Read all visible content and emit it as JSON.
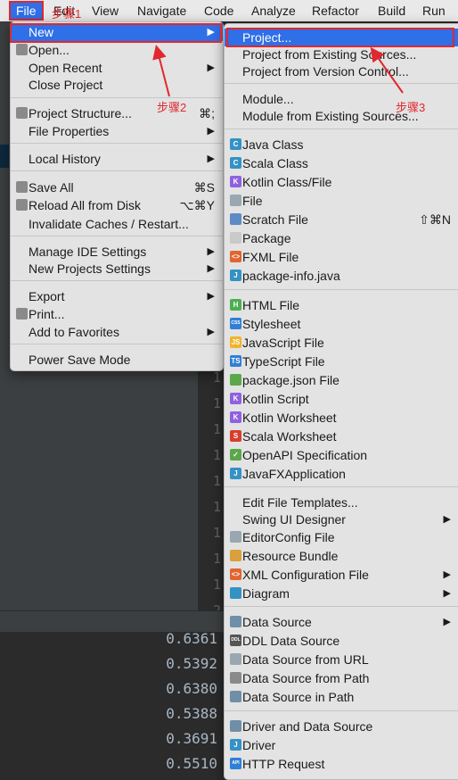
{
  "menubar": {
    "items": [
      "File",
      "Edit",
      "View",
      "Navigate",
      "Code",
      "Analyze",
      "Refactor",
      "Build",
      "Run"
    ]
  },
  "ide": {
    "gutter_numbers": [
      "1",
      "1",
      "1",
      "1",
      "1",
      "1",
      "1",
      "1",
      "1",
      "2"
    ],
    "output_values": [
      "0.6361",
      "0.5392",
      "0.6380",
      "0.5388",
      "0.3691",
      "0.5510"
    ]
  },
  "file_menu": {
    "items": [
      {
        "label": "New",
        "arrow": "▶",
        "selected": true
      },
      {
        "label": "Open...",
        "icon": "folder-icon"
      },
      {
        "label": "Open Recent",
        "arrow": "▶"
      },
      {
        "label": "Close Project"
      },
      {
        "label": "Project Structure...",
        "icon": "project-structure-icon",
        "shortcut": "⌘;"
      },
      {
        "label": "File Properties",
        "arrow": "▶"
      },
      {
        "label": "Local History",
        "arrow": "▶"
      },
      {
        "label": "Save All",
        "icon": "save-icon",
        "shortcut": "⌘S"
      },
      {
        "label": "Reload All from Disk",
        "icon": "reload-icon",
        "shortcut": "⌥⌘Y"
      },
      {
        "label": "Invalidate Caches / Restart..."
      },
      {
        "label": "Manage IDE Settings",
        "arrow": "▶"
      },
      {
        "label": "New Projects Settings",
        "arrow": "▶"
      },
      {
        "label": "Export",
        "arrow": "▶"
      },
      {
        "label": "Print...",
        "icon": "print-icon"
      },
      {
        "label": "Add to Favorites",
        "arrow": "▶"
      },
      {
        "label": "Power Save Mode"
      }
    ]
  },
  "new_menu": {
    "items": [
      {
        "label": "Project...",
        "selected": true
      },
      {
        "label": "Project from Existing Sources..."
      },
      {
        "label": "Project from Version Control..."
      },
      {
        "label": "Module..."
      },
      {
        "label": "Module from Existing Sources..."
      },
      {
        "label": "Java Class",
        "icon": "java-class-icon",
        "icon_text": "C",
        "color": "#3592c4"
      },
      {
        "label": "Scala Class",
        "icon": "scala-class-icon",
        "icon_text": "C",
        "color": "#3592c4"
      },
      {
        "label": "Kotlin Class/File",
        "icon": "kotlin-icon",
        "icon_text": "K",
        "color": "#8f61e0"
      },
      {
        "label": "File",
        "icon": "file-icon",
        "icon_text": "",
        "color": "#9aa7b0"
      },
      {
        "label": "Scratch File",
        "icon": "scratch-file-icon",
        "icon_text": "",
        "color": "#5c8bc6",
        "shortcut": "⇧⌘N"
      },
      {
        "label": "Package",
        "icon": "package-icon",
        "icon_text": "",
        "color": "#c9c9c9"
      },
      {
        "label": "FXML File",
        "icon": "fxml-icon",
        "icon_text": "<>",
        "color": "#e3642f"
      },
      {
        "label": "package-info.java",
        "icon": "java-file-icon",
        "icon_text": "J",
        "color": "#3592c4"
      },
      {
        "label": "HTML File",
        "icon": "html-icon",
        "icon_text": "H",
        "color": "#4caf50"
      },
      {
        "label": "Stylesheet",
        "icon": "css-icon",
        "icon_text": "CSS",
        "color": "#2f7fd6"
      },
      {
        "label": "JavaScript File",
        "icon": "js-icon",
        "icon_text": "JS",
        "color": "#f0b429"
      },
      {
        "label": "TypeScript File",
        "icon": "ts-icon",
        "icon_text": "TS",
        "color": "#2f7fd6"
      },
      {
        "label": "package.json File",
        "icon": "npm-icon",
        "icon_text": "",
        "color": "#5aa84a"
      },
      {
        "label": "Kotlin Script",
        "icon": "kotlin-script-icon",
        "icon_text": "K",
        "color": "#8f61e0"
      },
      {
        "label": "Kotlin Worksheet",
        "icon": "kotlin-worksheet-icon",
        "icon_text": "K",
        "color": "#8f61e0"
      },
      {
        "label": "Scala Worksheet",
        "icon": "scala-worksheet-icon",
        "icon_text": "S",
        "color": "#d73f2c"
      },
      {
        "label": "OpenAPI Specification",
        "icon": "openapi-icon",
        "icon_text": "✓",
        "color": "#5aa84a"
      },
      {
        "label": "JavaFXApplication",
        "icon": "javafx-icon",
        "icon_text": "J",
        "color": "#3592c4"
      },
      {
        "label": "Edit File Templates..."
      },
      {
        "label": "Swing UI Designer",
        "arrow": "▶"
      },
      {
        "label": "EditorConfig File",
        "icon": "editorconfig-icon",
        "icon_text": "",
        "color": "#9aa7b0"
      },
      {
        "label": "Resource Bundle",
        "icon": "resource-bundle-icon",
        "icon_text": "",
        "color": "#d9a03b"
      },
      {
        "label": "XML Configuration File",
        "icon": "xml-icon",
        "icon_text": "<>",
        "color": "#e3642f",
        "arrow": "▶"
      },
      {
        "label": "Diagram",
        "icon": "diagram-icon",
        "icon_text": "",
        "color": "#3592c4",
        "arrow": "▶"
      },
      {
        "label": "Data Source",
        "icon": "data-source-icon",
        "icon_text": "",
        "color": "#6f8fa8",
        "arrow": "▶"
      },
      {
        "label": "DDL Data Source",
        "icon": "ddl-icon",
        "icon_text": "DDL",
        "color": "#555555"
      },
      {
        "label": "Data Source from URL",
        "icon": "url-icon",
        "icon_text": "",
        "color": "#9aa7b0"
      },
      {
        "label": "Data Source from Path",
        "icon": "folder-icon",
        "icon_text": "",
        "color": "#8a8a8a"
      },
      {
        "label": "Data Source in Path",
        "icon": "data-source-path-icon",
        "icon_text": "",
        "color": "#6f8fa8"
      },
      {
        "label": "Driver and Data Source",
        "icon": "driver-ds-icon",
        "icon_text": "",
        "color": "#6f8fa8"
      },
      {
        "label": "Driver",
        "icon": "driver-icon",
        "icon_text": "J",
        "color": "#3592c4"
      },
      {
        "label": "HTTP Request",
        "icon": "http-icon",
        "icon_text": "API",
        "color": "#2f7fd6"
      }
    ]
  },
  "annotations": {
    "step1": "步骤1",
    "step2": "步骤2",
    "step3": "步骤3"
  },
  "colors": {
    "selection": "#2f6fe8",
    "annotation": "#e0282e",
    "menu_bg": "#e3e3e3"
  }
}
